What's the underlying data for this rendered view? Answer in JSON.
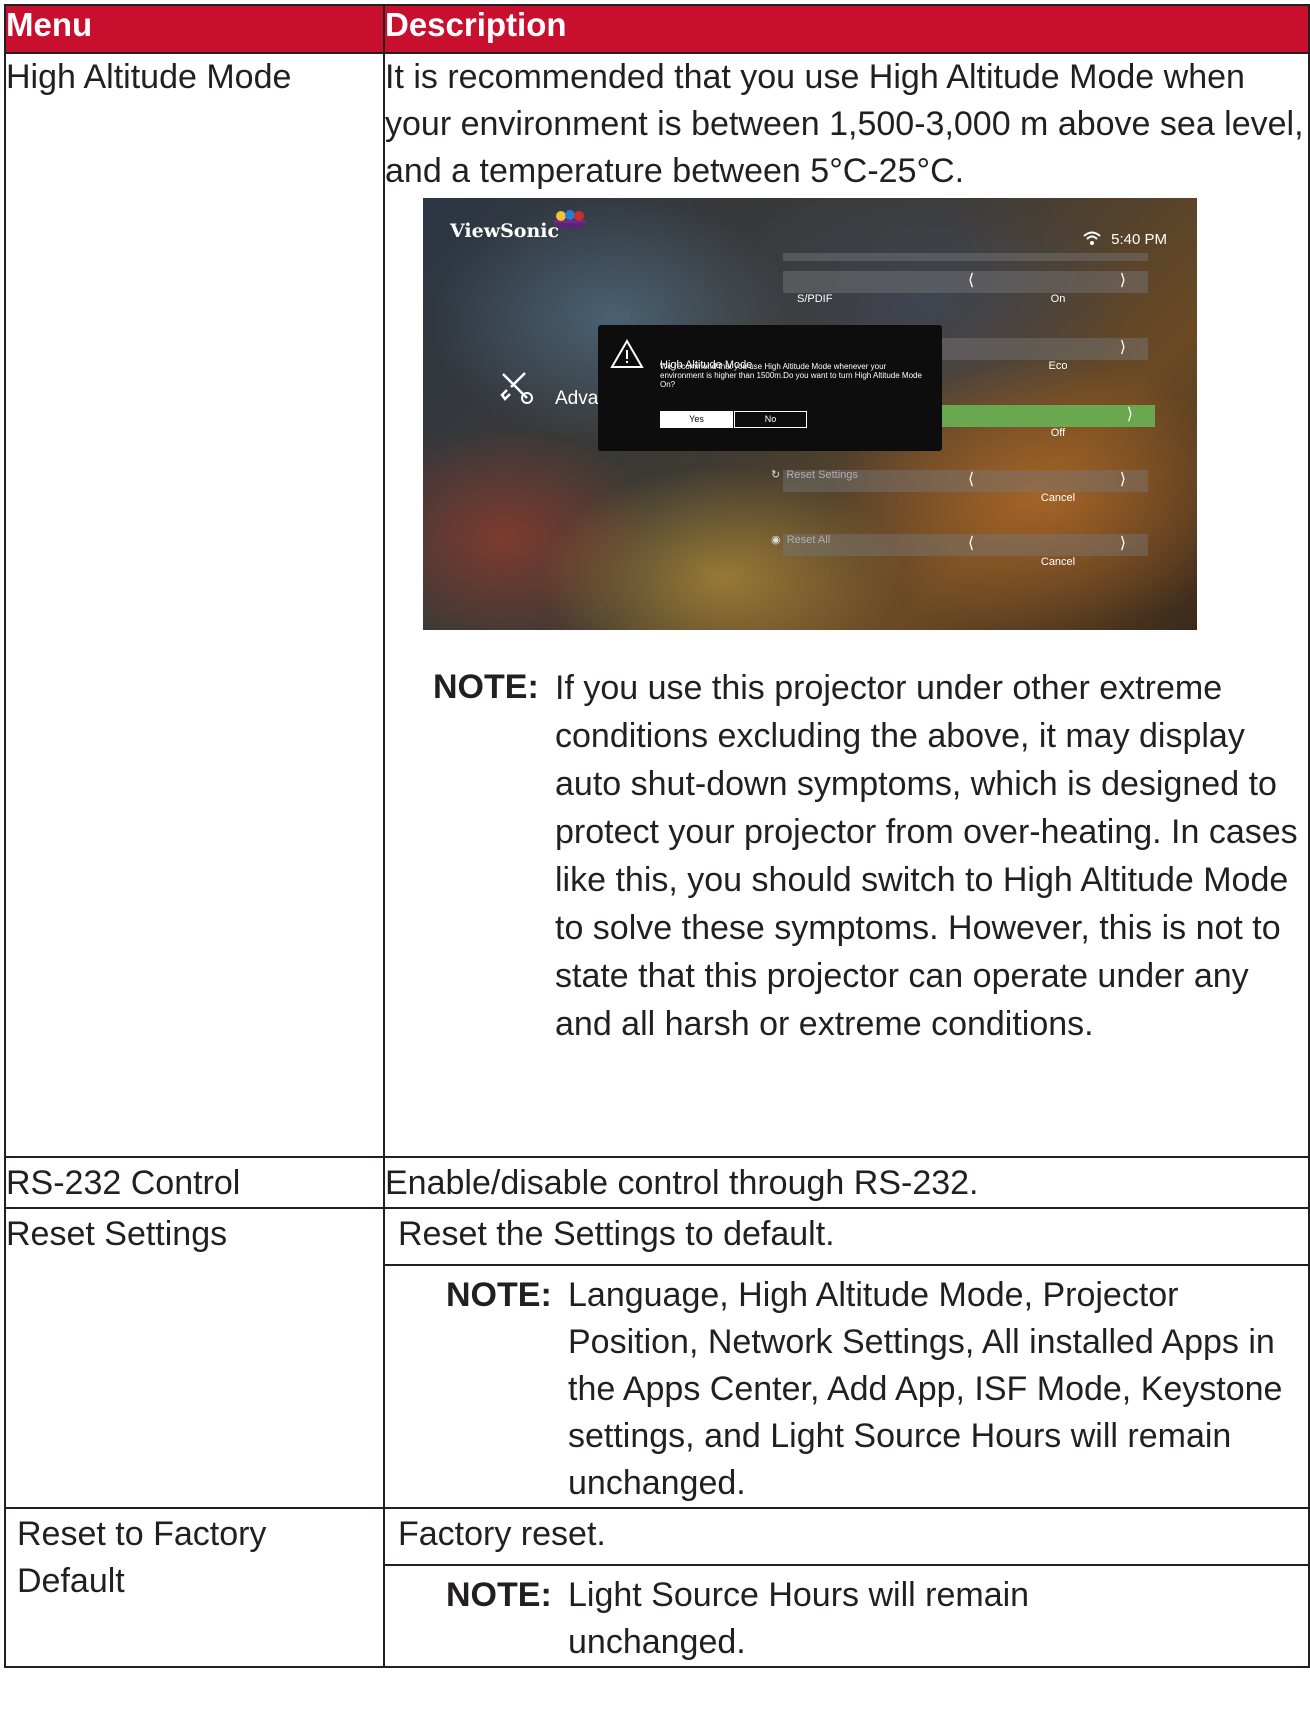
{
  "header": {
    "menu": "Menu",
    "description": "Description"
  },
  "rows": [
    {
      "menu": "High Altitude Mode",
      "description": "It is recommended that you use High Altitude Mode when your environment is between 1,500-3,000 m above sea level, and a temperature between 5°C-25°C.",
      "note_label": "NOTE:",
      "note": "If you use this projector under other extreme conditions excluding the above, it may display auto shut-down symptoms, which is designed to protect your projector from over-heating. In cases like this, you should switch to High Altitude Mode to solve these symptoms. However, this is not to state that this projector can operate under any and all harsh or extreme conditions."
    },
    {
      "menu": "RS-232 Control",
      "description": "Enable/disable control through RS-232."
    },
    {
      "menu": "Reset Settings",
      "description": "Reset the Settings to default.",
      "note_label": "NOTE:",
      "note": "Language, High Altitude Mode, Projector Position, Network Settings, All installed Apps in the Apps Center, Add App, ISF Mode, Keystone settings, and Light Source Hours will remain unchanged."
    },
    {
      "menu": "Reset to Factory Default",
      "description": "Factory reset.",
      "note_label": "NOTE:",
      "note": "Light Source Hours will remain unchanged."
    }
  ],
  "screenshot": {
    "brand": "ViewSonic",
    "time": "5:40 PM",
    "adv_label": "Advar",
    "settings": [
      {
        "name": "S/PDIF",
        "value": "On"
      },
      {
        "name": "",
        "value": "Eco"
      },
      {
        "name": "",
        "value": "Off"
      },
      {
        "name": "",
        "value": "Cancel"
      },
      {
        "name": "",
        "value": "Cancel"
      }
    ],
    "reset_settings_label": "Reset Settings",
    "reset_all_label": "Reset All",
    "dialog": {
      "title": "High Altitude Mode",
      "text": "We recommend that you use High Altitude Mode whenever your environment is higher than 1500m.Do you want to turn High Altitude Mode On?",
      "yes": "Yes",
      "no": "No"
    },
    "colors": {
      "selected_row": "#6aa84f",
      "header": "#c8102e"
    }
  }
}
